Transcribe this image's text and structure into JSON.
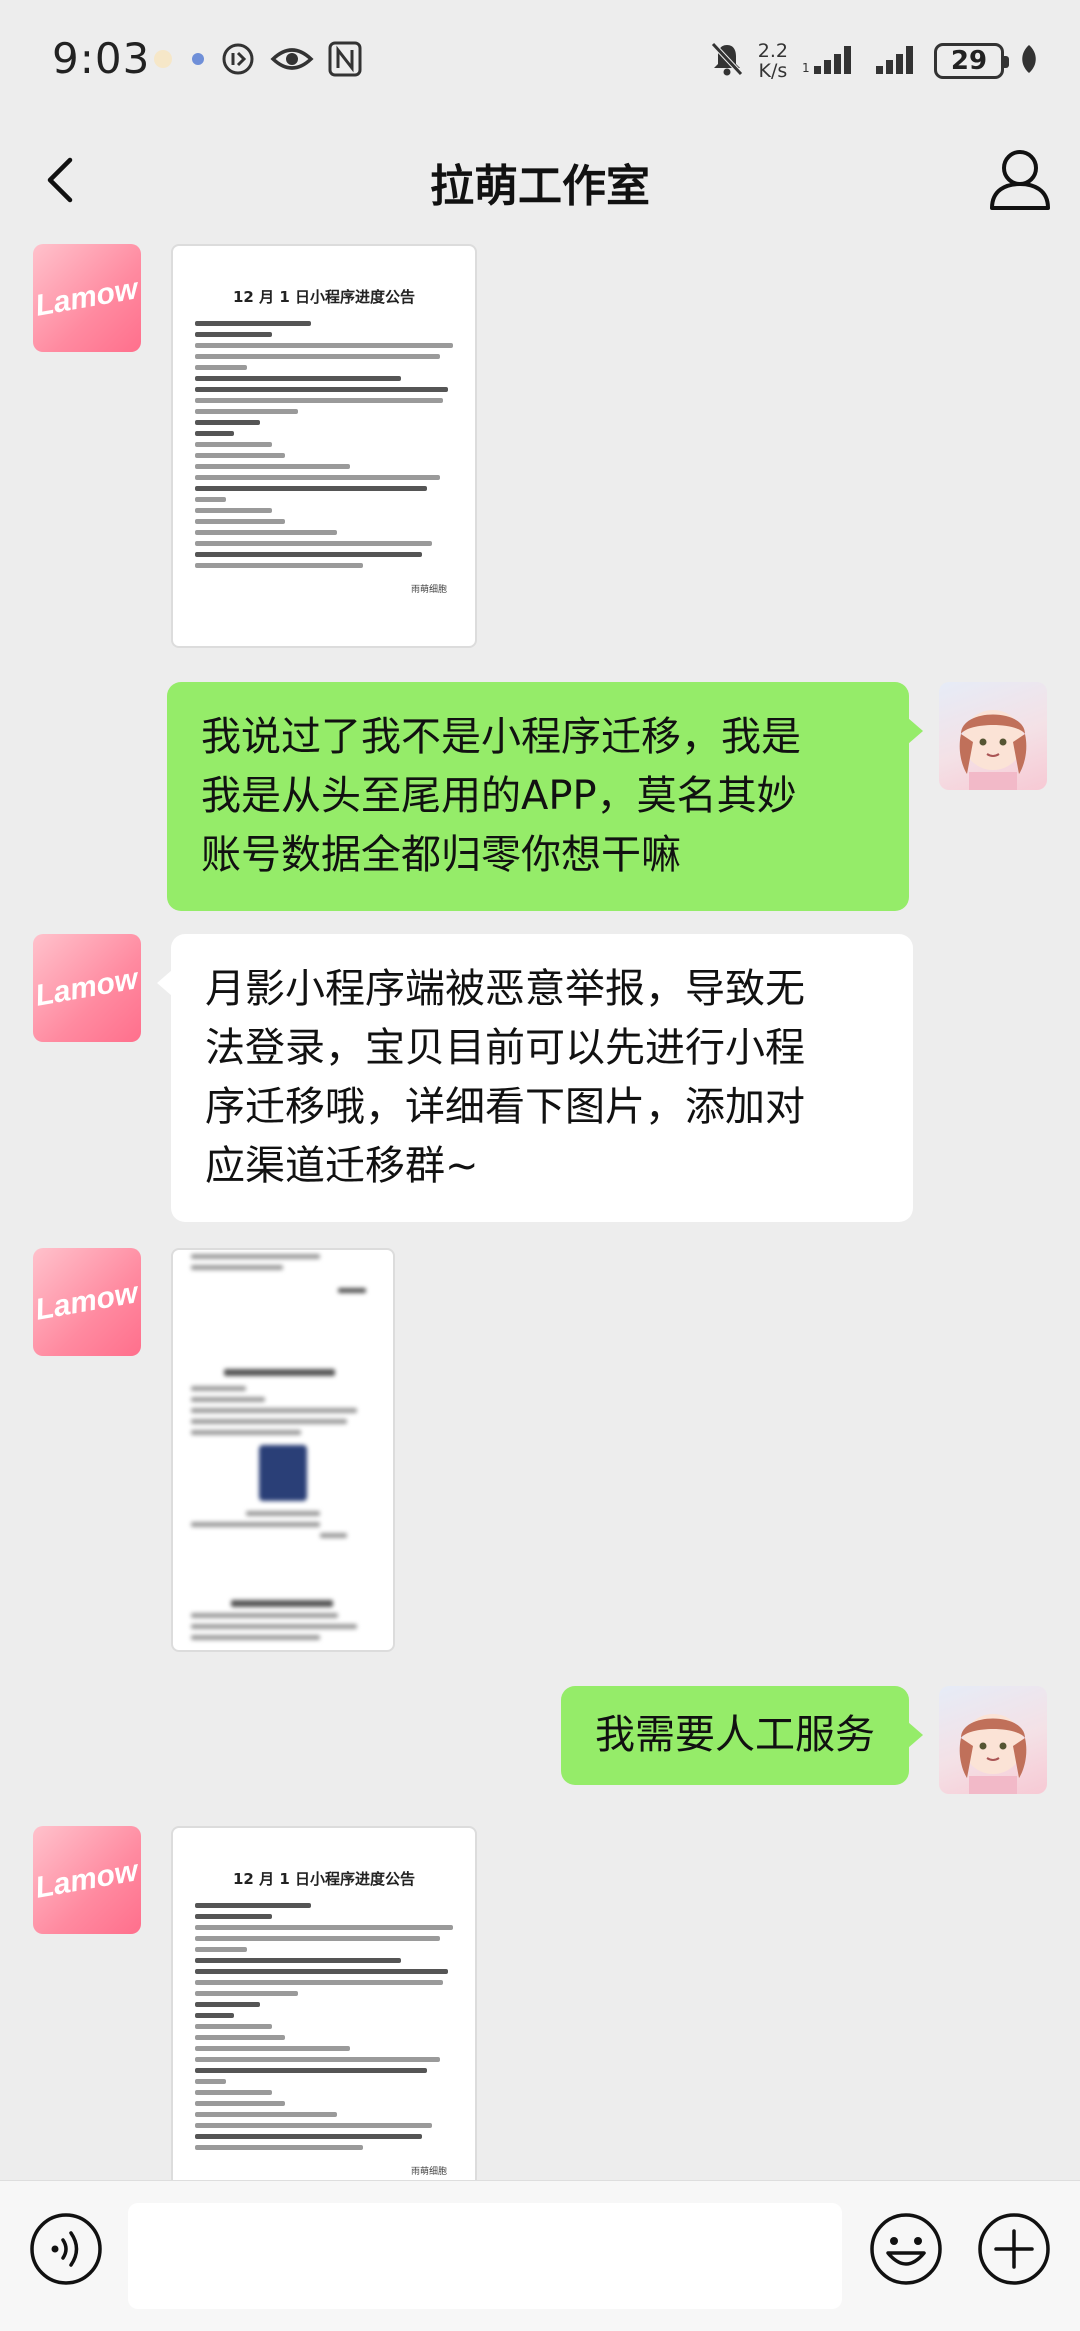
{
  "status_bar": {
    "time": "9:03",
    "net_speed_value": "2.2",
    "net_speed_unit": "K/s",
    "battery": "29"
  },
  "nav": {
    "title": "拉萌工作室"
  },
  "brand_avatar_text": "Lamow",
  "messages": {
    "doc1": {
      "title": "12 月 1 日小程序进度公告",
      "sign": "雨萌细胞"
    },
    "user1": {
      "line1": "我说过了我不是小程序迁移，我是",
      "line2": "我是从头至尾用的APP，莫名其妙",
      "line3": "账号数据全都归零你想干嘛"
    },
    "agent1": {
      "line1": "月影小程序端被恶意举报，导致无",
      "line2": "法登录，宝贝目前可以先进行小程",
      "line3": "序迁移哦，详细看下图片，添加对",
      "line4": "应渠道迁移群~"
    },
    "user2": {
      "text": "我需要人工服务"
    },
    "doc3": {
      "title": "12 月 1 日小程序进度公告",
      "sign": "雨萌细胞"
    }
  },
  "input": {
    "value": ""
  },
  "colors": {
    "background": "#ededed",
    "self_bubble": "#95ec69",
    "other_bubble": "#ffffff",
    "brand_pink": "#ff8aa0"
  }
}
